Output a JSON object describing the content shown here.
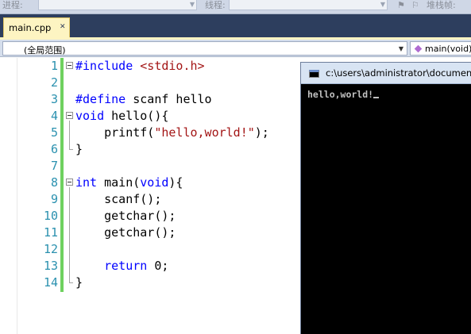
{
  "toolbar": {
    "process_label": "进程:",
    "thread_label": "线程:",
    "stack_label": "堆栈帧:"
  },
  "tab": {
    "label": "main.cpp",
    "close_glyph": "✕"
  },
  "navbar": {
    "scope_value": "(全局范围)",
    "member_value": "main(void)"
  },
  "editor": {
    "lines": [
      {
        "n": "1"
      },
      {
        "n": "2"
      },
      {
        "n": "3"
      },
      {
        "n": "4"
      },
      {
        "n": "5"
      },
      {
        "n": "6"
      },
      {
        "n": "7"
      },
      {
        "n": "8"
      },
      {
        "n": "9"
      },
      {
        "n": "10"
      },
      {
        "n": "11"
      },
      {
        "n": "12"
      },
      {
        "n": "13"
      },
      {
        "n": "14"
      }
    ],
    "code": {
      "l1_kw": "#include",
      "l1_inc": "<stdio.h>",
      "l3_kw": "#define",
      "l3_rest": " scanf hello",
      "l4_kw": "void",
      "l4_rest": " hello(){",
      "l5_pre": "    printf(",
      "l5_str": "\"hello,world!\"",
      "l5_post": ");",
      "l6": "}",
      "l8_kw": "int",
      "l8_mid": " main(",
      "l8_kw2": "void",
      "l8_post": "){",
      "l9": "    scanf();",
      "l10": "    getchar();",
      "l11": "    getchar();",
      "l13_pre": "    ",
      "l13_kw": "return",
      "l13_post": " 0;",
      "l14": "}"
    }
  },
  "console": {
    "title": "c:\\users\\administrator\\documents",
    "output": "hello,world!"
  },
  "colors": {
    "keyword": "#0000ff",
    "string": "#a31515",
    "line_number": "#2b91af",
    "change_bar": "#6fd15f",
    "tab_background": "#fdf4c2",
    "tab_band": "#2d3e5e"
  }
}
